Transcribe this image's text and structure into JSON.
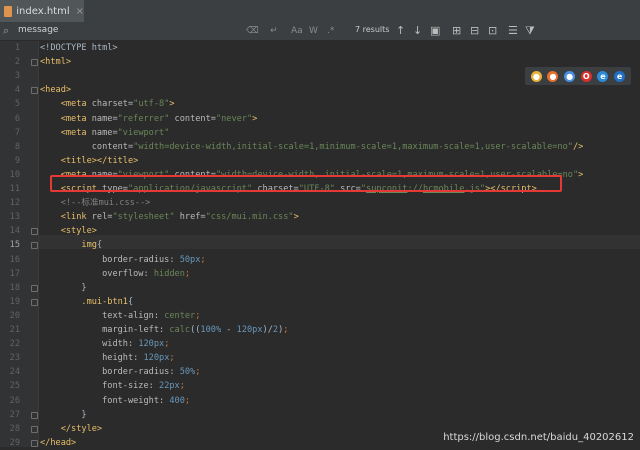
{
  "tab": {
    "filename": "index.html",
    "close_glyph": "×"
  },
  "find": {
    "query": "message",
    "results": "7 results",
    "case_label": "Aa",
    "word_label": "W",
    "regex_label": ".*"
  },
  "browsers": [
    {
      "name": "chrome-icon",
      "color": "#e9b23a",
      "glyph": "●"
    },
    {
      "name": "firefox-icon",
      "color": "#e8702a",
      "glyph": "●"
    },
    {
      "name": "safari-icon",
      "color": "#4a90e2",
      "glyph": "●"
    },
    {
      "name": "opera-icon",
      "color": "#d6302b",
      "glyph": "O"
    },
    {
      "name": "ie-icon",
      "color": "#2c8bd8",
      "glyph": "e"
    },
    {
      "name": "edge-icon",
      "color": "#1f6fc5",
      "glyph": "e"
    }
  ],
  "lines": [
    {
      "n": "1",
      "html": "<span class=\"txt\">&lt;!DOCTYPE html&gt;</span>"
    },
    {
      "n": "2",
      "html": "<span class=\"tag\">&lt;html&gt;</span>"
    },
    {
      "n": "3",
      "html": ""
    },
    {
      "n": "4",
      "html": "<span class=\"tag\">&lt;head&gt;</span>"
    },
    {
      "n": "5",
      "html": "    <span class=\"tag\">&lt;meta </span><span class=\"attr\">charset=</span><span class=\"val\">\"utf-8\"</span><span class=\"tag\">&gt;</span>"
    },
    {
      "n": "6",
      "html": "    <span class=\"tag\">&lt;meta </span><span class=\"attr\">name=</span><span class=\"val\">\"referrer\" </span><span class=\"attr\">content=</span><span class=\"val\">\"never\"</span><span class=\"tag\">&gt;</span>"
    },
    {
      "n": "7",
      "html": "    <span class=\"tag\">&lt;meta </span><span class=\"attr\">name=</span><span class=\"val\">\"viewport\"</span>"
    },
    {
      "n": "8",
      "html": "          <span class=\"attr\">content=</span><span class=\"val\">\"width=device-width,initial-scale=1,minimum-scale=1,maximum-scale=1,user-scalable=no\"</span><span class=\"tag\">/&gt;</span>"
    },
    {
      "n": "9",
      "html": "    <span class=\"tag\">&lt;title&gt;&lt;/title&gt;</span>"
    },
    {
      "n": "10",
      "html": "    <span class=\"tag\">&lt;meta </span><span class=\"attr\">name=</span><span class=\"val\">\"viewport\" </span><span class=\"attr\">content=</span><span class=\"val\">\"width=device-width, initial-scale=1,maximum-scale=1,user-scalable=no\"</span><span class=\"tag\">&gt;</span>"
    },
    {
      "n": "11",
      "html": "    <span class=\"tag\">&lt;script </span><span class=\"attr\">type=</span><span class=\"val\">\"application/javascript\" </span><span class=\"attr\">charset=</span><span class=\"val\">\"UTF-8\" </span><span class=\"attr\">src=</span><span class=\"val\">\"<u>supconit</u>://<u>hcmobile</u>.js\"</span><span class=\"tag\">&gt;&lt;/script&gt;</span>"
    },
    {
      "n": "12",
      "html": "    <span class=\"cmt\">&lt;!--标准mui.css--&gt;</span>"
    },
    {
      "n": "13",
      "html": "    <span class=\"tag\">&lt;link </span><span class=\"attr\">rel=</span><span class=\"val\">\"stylesheet\" </span><span class=\"attr\">href=</span><span class=\"val\">\"css/mui.min.css\"</span><span class=\"tag\">&gt;</span>"
    },
    {
      "n": "14",
      "html": "    <span class=\"tag\">&lt;style&gt;</span>"
    },
    {
      "n": "15",
      "html": "        <span class=\"sel\">img</span><span class=\"txt\">{</span>"
    },
    {
      "n": "16",
      "html": "            <span class=\"prop\">border-radius: </span><span class=\"num-lit\">50px</span><span class=\"kw\">;</span>"
    },
    {
      "n": "17",
      "html": "            <span class=\"prop\">overflow: </span><span class=\"val\">hidden</span><span class=\"kw\">;</span>"
    },
    {
      "n": "18",
      "html": "        <span class=\"txt\">}</span>"
    },
    {
      "n": "19",
      "html": "        <span class=\"sel\">.mui-btn1</span><span class=\"txt\">{</span>"
    },
    {
      "n": "20",
      "html": "            <span class=\"prop\">text-align: </span><span class=\"val\">center</span><span class=\"kw\">;</span>"
    },
    {
      "n": "21",
      "html": "            <span class=\"prop\">margin-left: </span><span class=\"val\">calc</span><span class=\"txt\">((</span><span class=\"num-lit\">100%</span><span class=\"txt\"> - </span><span class=\"num-lit\">120px</span><span class=\"txt\">)/</span><span class=\"num-lit\">2</span><span class=\"txt\">)</span><span class=\"kw\">;</span>"
    },
    {
      "n": "22",
      "html": "            <span class=\"prop\">width: </span><span class=\"num-lit\">120px</span><span class=\"kw\">;</span>"
    },
    {
      "n": "23",
      "html": "            <span class=\"prop\">height: </span><span class=\"num-lit\">120px</span><span class=\"kw\">;</span>"
    },
    {
      "n": "24",
      "html": "            <span class=\"prop\">border-radius: </span><span class=\"num-lit\">50%</span><span class=\"kw\">;</span>"
    },
    {
      "n": "25",
      "html": "            <span class=\"prop\">font-size: </span><span class=\"num-lit\">22px</span><span class=\"kw\">;</span>"
    },
    {
      "n": "26",
      "html": "            <span class=\"prop\">font-weight: </span><span class=\"num-lit\">400</span><span class=\"kw\">;</span>"
    },
    {
      "n": "27",
      "html": "        <span class=\"txt\">}</span>"
    },
    {
      "n": "28",
      "html": "    <span class=\"tag\">&lt;/style&gt;</span>"
    },
    {
      "n": "29",
      "html": "<span class=\"tag\">&lt;/head&gt;</span>"
    }
  ],
  "current_line": "15",
  "watermark": "https://blog.csdn.net/baidu_40202612"
}
